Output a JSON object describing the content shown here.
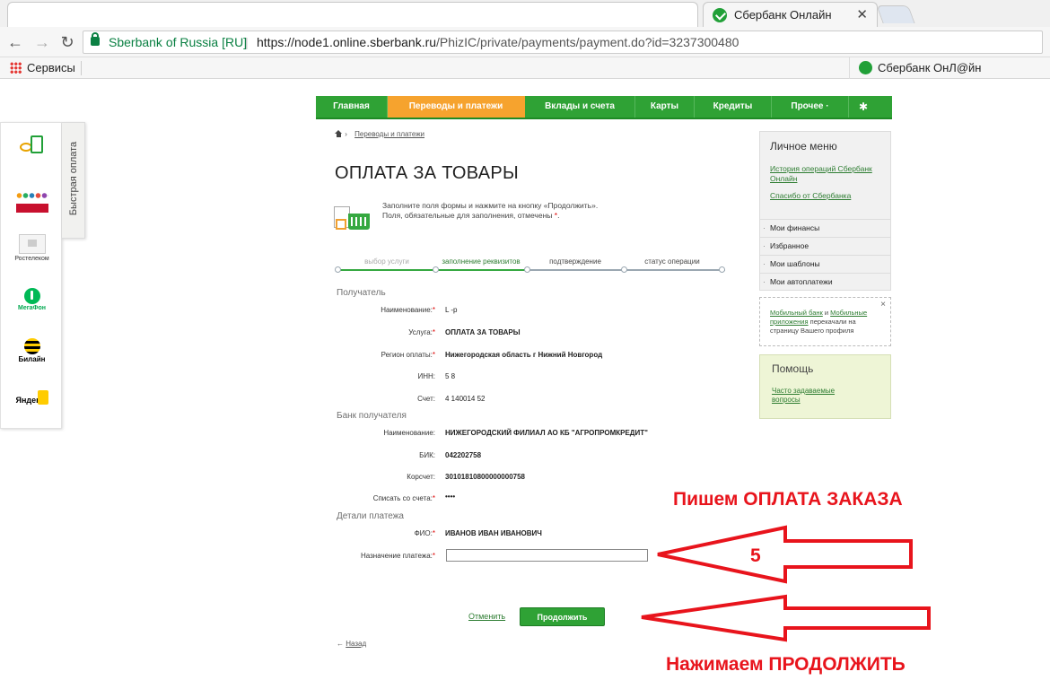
{
  "browser": {
    "active_tab_title": "Сбербанк Онлайн",
    "cert_label": "Sberbank of Russia [RU]",
    "url_origin": "https://node1.online.sberbank.ru",
    "url_path": "/PhizIC/private/payments/payment.do?id=3237300480",
    "bookmarks_apps_label": "Сервисы",
    "bookmark_right_label": "Сбербанк ОнЛ@йн"
  },
  "quick_pay": {
    "tab_label": "Быстрая оплата",
    "items": [
      {
        "icon": "mobile-payment-icon",
        "caption": ""
      },
      {
        "icon": "people-logo-icon",
        "caption": ""
      },
      {
        "icon": "rostelecom-logo-icon",
        "caption": "Ростелеком"
      },
      {
        "icon": "megafon-logo-icon",
        "caption": "МегаФон"
      },
      {
        "icon": "beeline-logo-icon",
        "caption": "Билайн"
      },
      {
        "icon": "yandex-logo-icon",
        "caption": "Яндекс"
      }
    ]
  },
  "nav": {
    "items": [
      "Главная",
      "Переводы и платежи",
      "Вклады и счета",
      "Карты",
      "Кредиты",
      "Прочее ·"
    ],
    "active_index": 1,
    "settings_icon": "gear-icon"
  },
  "breadcrumb": {
    "link": "Переводы и платежи"
  },
  "page": {
    "title": "ОПЛАТА ЗА ТОВАРЫ",
    "hint_line1": "Заполните поля формы и нажмите на кнопку «Продолжить».",
    "hint_line2_prefix": "Поля, обязательные для заполнения, отмечены ",
    "hint_line2_mark": "*",
    "hint_line2_suffix": "."
  },
  "steps": [
    "выбор услуги",
    "заполнение реквизитов",
    "подтверждение",
    "статус операции"
  ],
  "form": {
    "section_recipient": "Получатель",
    "section_bank": "Банк получателя",
    "section_details": "Детали платежа",
    "required_mark": "*",
    "fields": {
      "name_label": "Наименование:",
      "name_value": "L      -p",
      "service_label": "Услуга:",
      "service_value": "ОПЛАТА ЗА ТОВАРЫ",
      "region_label": "Регион оплаты:",
      "region_value": "Нижегородская область г Нижний Новгород",
      "inn_label": "ИНН:",
      "inn_value": "5          8",
      "account_label": "Счет:",
      "account_value": "4        140014         52",
      "bank_name_label": "Наименование:",
      "bank_name_value": "НИЖЕГОРОДСКИЙ ФИЛИАЛ АО КБ \"АГРОПРОМКРЕДИТ\"",
      "bik_label": "БИК:",
      "bik_value": "042202758",
      "corr_label": "Корсчет:",
      "corr_value": "30101810800000000758",
      "debit_label": "Списать со счета:",
      "debit_value": "••••",
      "fio_label": "ФИО:",
      "fio_value": "ИВАНОВ ИВАН ИВАНОВИЧ",
      "purpose_label": "Назначение платежа:",
      "purpose_value": ""
    },
    "cancel_label": "Отменить",
    "continue_label": "Продолжить",
    "back_arrow": "←",
    "back_label": "Назад"
  },
  "sidebar": {
    "menu_title": "Личное меню",
    "links": [
      "История операций Сбербанк Онлайн",
      "Спасибо от Сбербанка"
    ],
    "items": [
      "Мои финансы",
      "Избранное",
      "Мои шаблоны",
      "Мои автоплатежи"
    ],
    "mobile_note_link1": "Мобильный банк",
    "mobile_note_and": " и ",
    "mobile_note_link2": "Мобильные приложения",
    "mobile_note_rest": " перекачали на страницу Вашего профиля",
    "mobile_close": "×",
    "help_title": "Помощь",
    "help_link": "Часто задаваемые вопросы"
  },
  "annotations": {
    "top_text": "Пишем ОПЛАТА ЗАКАЗА",
    "step_number": "5",
    "bottom_text": "Нажимаем ПРОДОЛЖИТЬ",
    "color": "#e8141c"
  },
  "colors": {
    "brand_green": "#2fa235",
    "active_orange": "#f6a32e",
    "link_green": "#2e7d32",
    "required_red": "#dd0000"
  }
}
